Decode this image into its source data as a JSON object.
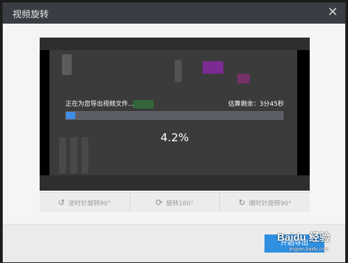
{
  "dialog": {
    "title": "视频旋转",
    "close_label": "✕"
  },
  "progress": {
    "label": "正在为您导出视频文件...",
    "remaining": "估算剩余：3分45秒",
    "percent_text": "4.2%",
    "percent_value": 4.2
  },
  "rotate": {
    "ccw90_label": "逆时针旋转90°",
    "rot180_label": "旋转180°",
    "cw90_label": "顺时针旋转90°"
  },
  "footer": {
    "export_label": "开始导出"
  },
  "watermark": {
    "main": "Baidu 经验",
    "sub": "jingyan.baidu.com"
  },
  "colors": {
    "accent": "#2f8fe0",
    "progress": "#3d8ee8",
    "titlebar": "#3a3d43"
  }
}
